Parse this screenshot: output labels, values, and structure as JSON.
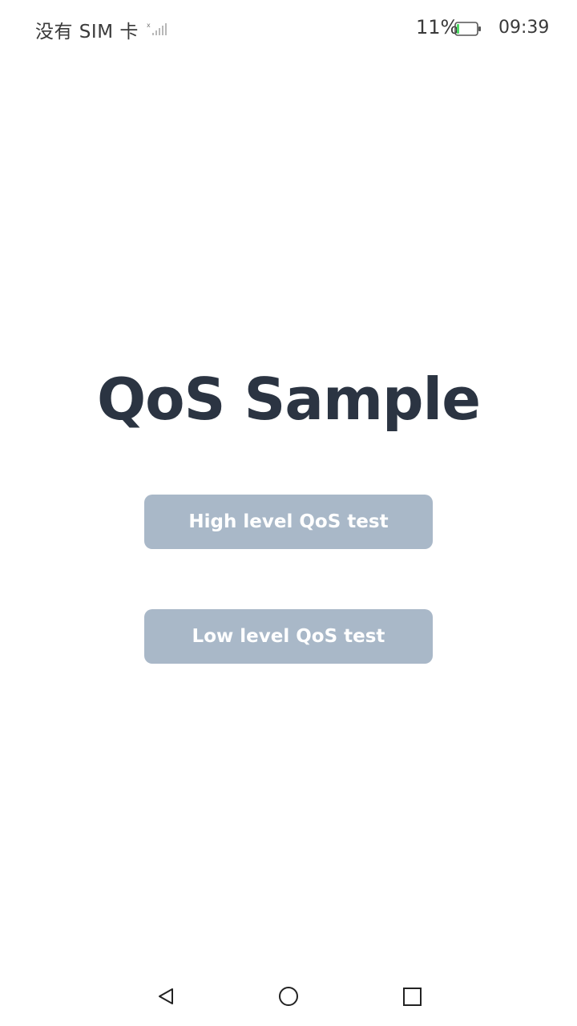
{
  "status_bar": {
    "carrier": "没有 SIM 卡",
    "battery_percent": "11%",
    "battery_level": 0.11,
    "time": "09:39",
    "icons": [
      "signal-icon",
      "battery-icon"
    ]
  },
  "main": {
    "title": "QoS Sample",
    "buttons": {
      "high": "High level QoS test",
      "low": "Low level QoS test"
    }
  },
  "nav_bar": {
    "icons": [
      "back-icon",
      "home-icon",
      "recent-apps-icon"
    ]
  },
  "colors": {
    "title": "#2b3442",
    "button_bg": "#a9b8c8",
    "button_text": "#ffffff",
    "battery_fill": "#4cd964"
  }
}
